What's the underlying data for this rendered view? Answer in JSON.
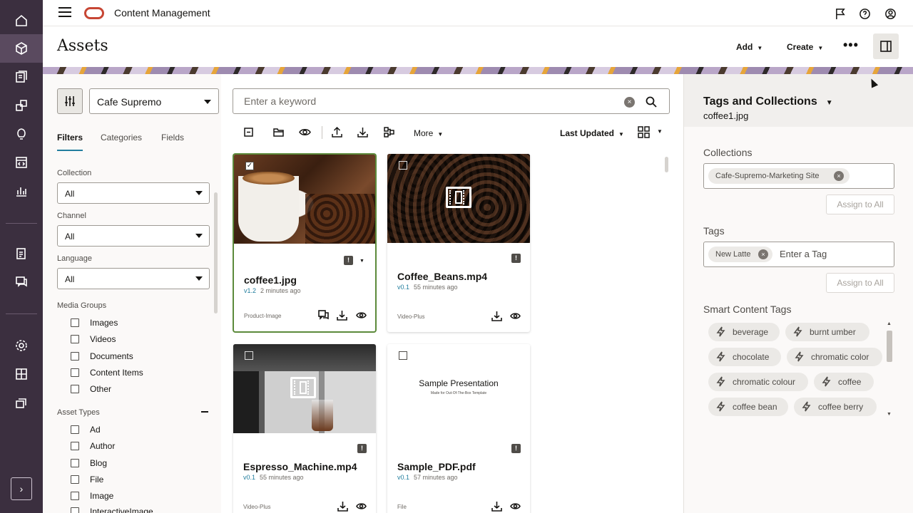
{
  "app": {
    "title": "Content Management",
    "brand_color": "#c74634",
    "rail_color": "#3b2f3f"
  },
  "rail": {
    "items": [
      {
        "name": "home-icon"
      },
      {
        "name": "assets-cube-icon"
      },
      {
        "name": "content-icon"
      },
      {
        "name": "components-icon"
      },
      {
        "name": "ideas-bulb-icon"
      },
      {
        "name": "developer-icon"
      },
      {
        "name": "analytics-chart-icon"
      },
      {
        "name": "documents-icon"
      },
      {
        "name": "conversations-icon"
      },
      {
        "name": "settings-gear-icon"
      },
      {
        "name": "integrations-icon"
      },
      {
        "name": "publishing-icon"
      }
    ],
    "expand_glyph": "›"
  },
  "header": {
    "page_title": "Assets",
    "add_label": "Add",
    "create_label": "Create",
    "more_glyph": "•••"
  },
  "filters": {
    "repository": "Cafe Supremo",
    "tabs": [
      "Filters",
      "Categories",
      "Fields"
    ],
    "collection_label": "Collection",
    "collection_value": "All",
    "channel_label": "Channel",
    "channel_value": "All",
    "language_label": "Language",
    "language_value": "All",
    "media_groups_label": "Media Groups",
    "media_groups": [
      "Images",
      "Videos",
      "Documents",
      "Content Items",
      "Other"
    ],
    "asset_types_label": "Asset Types",
    "asset_types": [
      "Ad",
      "Author",
      "Blog",
      "File",
      "Image",
      "InteractiveImage"
    ]
  },
  "search": {
    "placeholder": "Enter a keyword",
    "clear_glyph": "×"
  },
  "toolbar": {
    "more_label": "More",
    "sort_label": "Last Updated"
  },
  "assets": [
    {
      "name": "coffee1.jpg",
      "version": "v1.2",
      "updated": "2 minutes ago",
      "type": "Product-Image",
      "selected": true,
      "check": "✓"
    },
    {
      "name": "Coffee_Beans.mp4",
      "version": "v0.1",
      "updated": "55 minutes ago",
      "type": "Video-Plus",
      "selected": false
    },
    {
      "name": "Espresso_Machine.mp4",
      "version": "v0.1",
      "updated": "55 minutes ago",
      "type": "Video-Plus",
      "selected": false
    },
    {
      "name": "Sample_PDF.pdf",
      "version": "v0.1",
      "updated": "57 minutes ago",
      "type": "File",
      "selected": false,
      "thumb_title": "Sample Presentation",
      "thumb_subtitle": "Made for Out-Of-The-Box Template"
    }
  ],
  "info_glyph": "!",
  "panel": {
    "title": "Tags and Collections",
    "file": "coffee1.jpg",
    "collections_label": "Collections",
    "collection_chip": "Cafe-Supremo-Marketing Site",
    "assign_label": "Assign to All",
    "tags_label": "Tags",
    "tag_chip": "New Latte",
    "tag_placeholder": "Enter a Tag",
    "smart_label": "Smart Content Tags",
    "smart_tags": [
      "beverage",
      "burnt umber",
      "chocolate",
      "chromatic color",
      "chromatic colour",
      "coffee",
      "coffee bean",
      "coffee berry"
    ],
    "chip_x": "×",
    "scroll_up": "▲",
    "scroll_down": "▼"
  }
}
